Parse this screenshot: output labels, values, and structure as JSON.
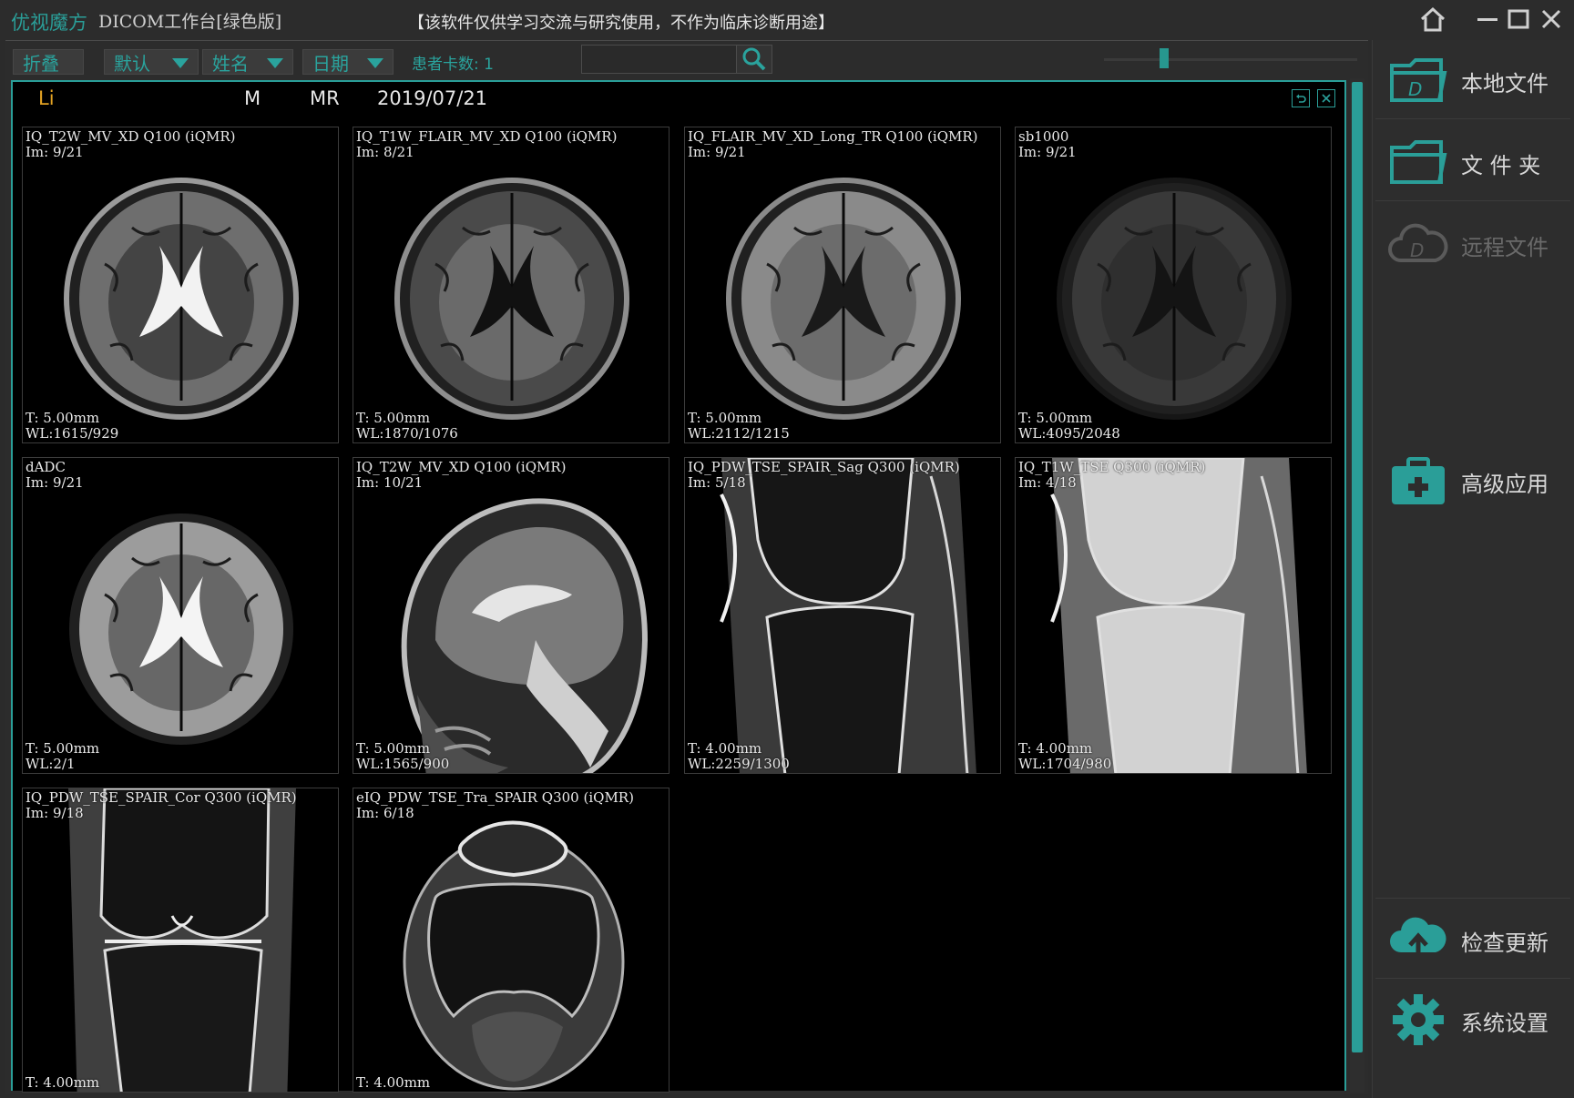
{
  "app": {
    "brand": "优视魔方",
    "subtitle": "DICOM工作台[绿色版]",
    "disclaimer": "【该软件仅供学习交流与研究使用，不作为临床诊断用途】"
  },
  "window_controls": [
    "home-icon",
    "minimize-icon",
    "maximize-icon",
    "close-icon"
  ],
  "toolbar": {
    "collapse_label": "折叠",
    "sort_default_label": "默认",
    "sort_name_label": "姓名",
    "sort_date_label": "日期",
    "patient_count": "患者卡数: 1",
    "search": {
      "value": "",
      "placeholder": ""
    },
    "slider_value": 0.22
  },
  "patient": {
    "name": "Li",
    "sex": "M",
    "modality": "MR",
    "date": "2019/07/21"
  },
  "series": [
    {
      "title": "IQ_T2W_MV_XD Q100 (iQMR)",
      "im": "Im: 9/21",
      "thickness": "T: 5.00mm",
      "wl": "WL:1615/929",
      "kind": "brain-axial-t2"
    },
    {
      "title": "IQ_T1W_FLAIR_MV_XD Q100 (iQMR)",
      "im": "Im: 8/21",
      "thickness": "T: 5.00mm",
      "wl": "WL:1870/1076",
      "kind": "brain-axial-t1"
    },
    {
      "title": "IQ_FLAIR_MV_XD_Long_TR Q100 (iQMR)",
      "im": "Im: 9/21",
      "thickness": "T: 5.00mm",
      "wl": "WL:2112/1215",
      "kind": "brain-axial-flair"
    },
    {
      "title": "sb1000",
      "im": "Im: 9/21",
      "thickness": "T: 5.00mm",
      "wl": "WL:4095/2048",
      "kind": "brain-axial-dwi"
    },
    {
      "title": "dADC",
      "im": "Im: 9/21",
      "thickness": "T: 5.00mm",
      "wl": "WL:2/1",
      "kind": "brain-axial-adc"
    },
    {
      "title": "IQ_T2W_MV_XD Q100 (iQMR)",
      "im": "Im: 10/21",
      "thickness": "T: 5.00mm",
      "wl": "WL:1565/900",
      "kind": "brain-sagittal"
    },
    {
      "title": "IQ_PDW_TSE_SPAIR_Sag Q300 (iQMR)",
      "im": "Im: 5/18",
      "thickness": "T: 4.00mm",
      "wl": "WL:2259/1300",
      "kind": "knee-sag-pd"
    },
    {
      "title": "IQ_T1W_TSE Q300 (iQMR)",
      "im": "Im: 4/18",
      "thickness": "T: 4.00mm",
      "wl": "WL:1704/980",
      "kind": "knee-sag-t1"
    },
    {
      "title": "IQ_PDW_TSE_SPAIR_Cor Q300 (iQMR)",
      "im": "Im: 9/18",
      "thickness": "T: 4.00mm",
      "wl": "",
      "kind": "knee-coronal"
    },
    {
      "title": "eIQ_PDW_TSE_Tra_SPAIR Q300 (iQMR)",
      "im": "Im: 6/18",
      "thickness": "T: 4.00mm",
      "wl": "",
      "kind": "knee-axial"
    }
  ],
  "sidebar": {
    "local_files": "本地文件",
    "folder": "文 件 夹",
    "remote_files": "远程文件",
    "advanced": "高级应用",
    "check_update": "检查更新",
    "settings": "系统设置"
  },
  "colors": {
    "accent": "#2a9e98",
    "patient_name": "#e3a223",
    "background": "#2b2b2b"
  }
}
